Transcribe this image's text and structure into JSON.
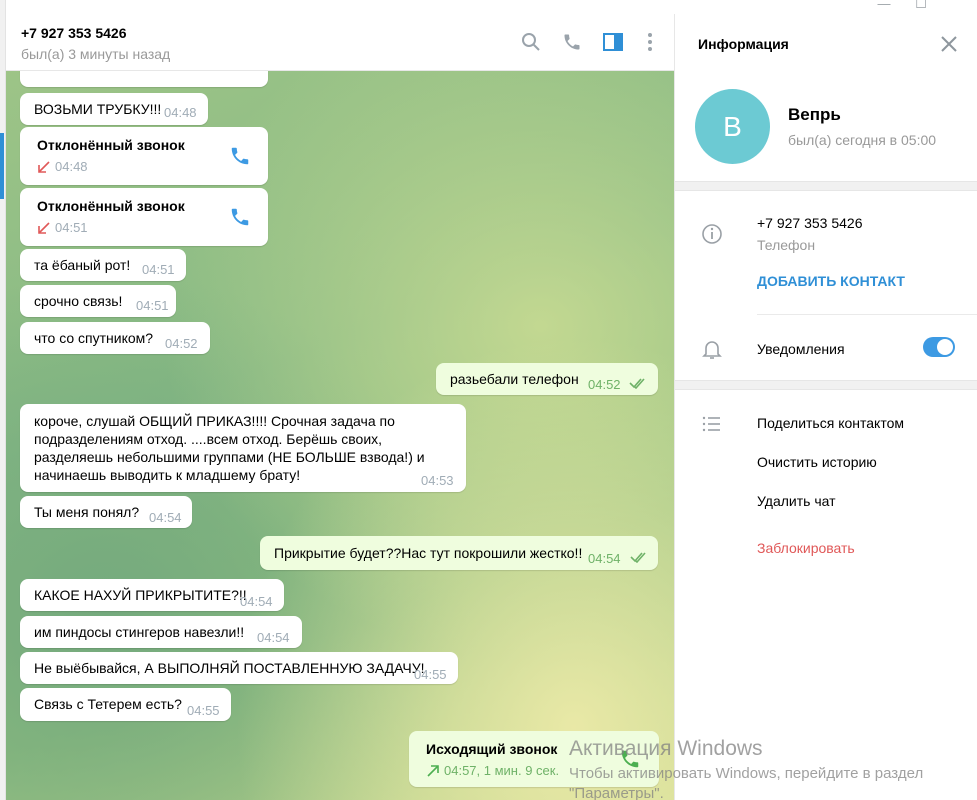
{
  "window": {
    "minimize": "—",
    "maximize": "☐"
  },
  "header": {
    "title": "+7 927 353 5426",
    "status": "был(а) 3 минуты назад"
  },
  "messages": [
    {
      "type": "in",
      "text": "ВОЗЬМИ ТРУБКУ!!!",
      "time": "04:48"
    },
    {
      "type": "call_in",
      "title": "Отклонённый звонок",
      "time": "04:48"
    },
    {
      "type": "call_in",
      "title": "Отклонённый звонок",
      "time": "04:51"
    },
    {
      "type": "in",
      "text": "та ёбаный рот!",
      "time": "04:51"
    },
    {
      "type": "in",
      "text": "срочно связь!",
      "time": "04:51"
    },
    {
      "type": "in",
      "text": "что со спутником?",
      "time": "04:52"
    },
    {
      "type": "out",
      "text": "разьебали телефон",
      "time": "04:52"
    },
    {
      "type": "in",
      "text": "короче, слушай ОБЩИЙ ПРИКАЗ!!!! Срочная задача по подразделениям отход. ....всем отход. Берёшь своих, разделяешь небольшими группами (НЕ БОЛЬШЕ взвода!) и начинаешь выводить к младшему брату!",
      "time": "04:53"
    },
    {
      "type": "in",
      "text": "Ты меня понял?",
      "time": "04:54"
    },
    {
      "type": "out",
      "text": "Прикрытие будет??Нас тут покрошили жестко!!",
      "time": "04:54"
    },
    {
      "type": "in",
      "text": "КАКОЕ НАХУЙ ПРИКРЫТИТЕ?!!",
      "time": "04:54"
    },
    {
      "type": "in",
      "text": "им пиндосы стингеров навезли!!",
      "time": "04:54"
    },
    {
      "type": "in",
      "text": "Не выёбывайся, А ВЫПОЛНЯЙ ПОСТАВЛЕННУЮ ЗАДАЧУ!",
      "time": "04:55"
    },
    {
      "type": "in",
      "text": "Связь с Тетерем есть?",
      "time": "04:55"
    },
    {
      "type": "call_out",
      "title": "Исходящий звонок",
      "meta": "04:57, 1 мин. 9 сек."
    }
  ],
  "watermark": {
    "line1": "Активация Windows",
    "line2": "Чтобы активировать Windows, перейдите в раздел",
    "line3": "\"Параметры\"."
  },
  "info": {
    "title": "Информация",
    "avatar_letter": "В",
    "name": "Вепрь",
    "status": "был(а) сегодня в 05:00",
    "phone": "+7 927 353 5426",
    "phone_label": "Телефон",
    "add_contact": "ДОБАВИТЬ КОНТАКТ",
    "notifications": "Уведомления",
    "notifications_on": true,
    "share": "Поделиться контактом",
    "clear": "Очистить историю",
    "delete": "Удалить чат",
    "block": "Заблокировать"
  },
  "colors": {
    "accent": "#2f8fd6",
    "avatar": "#6ccad3",
    "declined_arrow": "#e05858",
    "outgoing": "#effdde",
    "block": "#e05858"
  }
}
